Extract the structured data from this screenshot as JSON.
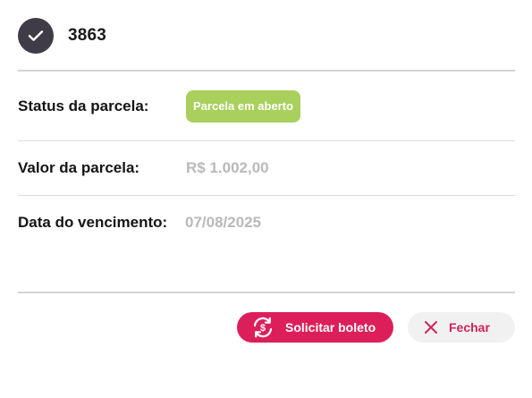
{
  "header": {
    "title": "3863",
    "icon": "check-icon"
  },
  "rows": [
    {
      "label": "Status da parcela:",
      "value": "Parcela em aberto",
      "kind": "badge"
    },
    {
      "label": "Valor da parcela:",
      "value": "R$ 1.002,00",
      "kind": "text"
    },
    {
      "label": "Data do vencimento:",
      "value": "07/08/2025",
      "kind": "text"
    }
  ],
  "actions": {
    "request_boleto_label": "Solicitar boleto",
    "request_boleto_icon": "sync-currency-icon",
    "close_label": "Fechar",
    "close_icon": "close-icon"
  },
  "colors": {
    "primary": "#dc1f5b",
    "status_open": "#a9cf5c",
    "header_circle": "#3f3c46",
    "muted_value": "#b9b9b9"
  }
}
